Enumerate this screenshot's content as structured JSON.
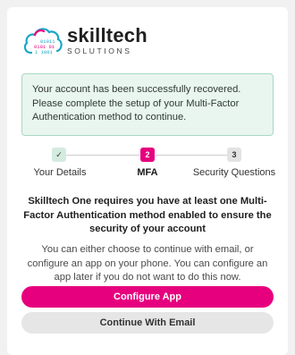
{
  "brand": {
    "name": "skilltech",
    "tagline": "SOLUTIONS",
    "logo_icon": "cloud-binary-icon",
    "binary_lines": [
      "01011",
      "0101 01",
      "1 1001"
    ],
    "colors": {
      "cloud_outline": "#1aa6c9",
      "cloud_accent": "#e6007e"
    }
  },
  "alert": {
    "message": "Your account has been successfully recovered. Please complete the setup of your Multi-Factor Authentication method to continue."
  },
  "stepper": {
    "steps": [
      {
        "badge": "✓",
        "label": "Your Details",
        "state": "completed"
      },
      {
        "badge": "2",
        "label": "MFA",
        "state": "active"
      },
      {
        "badge": "3",
        "label": "Security Questions",
        "state": "pending"
      }
    ]
  },
  "heading": "Skilltech One requires you have at least one Multi-Factor Authentication method enabled to ensure the security of your account",
  "description": "You can either choose to continue with email, or configure an app on your phone. You can configure an app later if you do not want to do this now.",
  "actions": {
    "primary_label": "Configure App",
    "secondary_label": "Continue With Email"
  },
  "colors": {
    "accent": "#e6007e",
    "alert_bg": "#e9f5ef",
    "alert_border": "#a9d9c2",
    "page_bg": "#f1f1f1"
  }
}
